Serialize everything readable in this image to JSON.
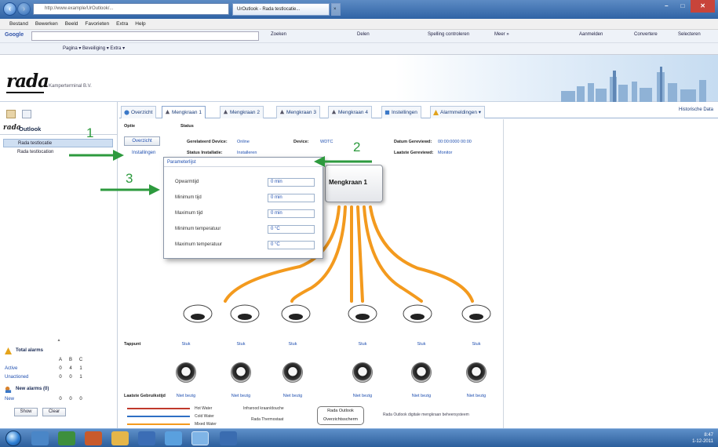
{
  "browser": {
    "tab_active": "UrOutlook - Rada testlocatie...",
    "tab_close": "×",
    "address": "http://www.example/UrOutlook/...",
    "menu": [
      "Bestand",
      "Bewerken",
      "Beeld",
      "Favorieten",
      "Extra",
      "Help"
    ],
    "google_label": "Google",
    "toolbar1_items": [
      "Zoeken",
      "Delen",
      "Spelling controleren",
      "Meer »",
      "Aanmelden"
    ],
    "toolbar2": "Pagina ▾   Beveiliging ▾   Extra ▾",
    "toolbar2_right": [
      "Convertere",
      "Selecteren"
    ]
  },
  "app": {
    "logo": "rada",
    "user_line": "Kamperterminal B.V.",
    "outlook_logo": "rada",
    "outlook_title": "Outlook",
    "historic_link": "Historische Data",
    "tabs": [
      {
        "label": "Overzicht"
      },
      {
        "label": "Mengkraan 1"
      },
      {
        "label": "Mengkraan 2"
      },
      {
        "label": "Mengkraan 3"
      },
      {
        "label": "Mengkraan 4"
      },
      {
        "label": "Instellingen"
      },
      {
        "label": "Alarmmeldingen ▾"
      }
    ]
  },
  "left_panel": {
    "items": [
      "Rada testlocatie",
      "Rada testlocation"
    ],
    "alarms": {
      "total_title": "Total alarms",
      "cols": [
        "A",
        "B",
        "C"
      ],
      "rows": [
        {
          "label": "Active",
          "vals": [
            "0",
            "4",
            "1"
          ]
        },
        {
          "label": "Unactioned",
          "vals": [
            "0",
            "0",
            "1"
          ]
        }
      ],
      "new_title": "New alarms (0)",
      "new_row": {
        "label": "New",
        "vals": [
          "0",
          "0",
          "0"
        ]
      },
      "show_btn": "Show",
      "clear_btn": "Clear"
    }
  },
  "main": {
    "option_label": "Optie",
    "status_label": "Status",
    "overview_btn": "Overzicht",
    "install_link": "Installingen",
    "info": [
      {
        "label": "Gerelateerd Device:",
        "value": "Online"
      },
      {
        "label": "Device:",
        "value": "WDTC"
      },
      {
        "label": "Datum Gereviewd:",
        "value": "00:00:0000 00:00"
      },
      {
        "label": "Status Installatie:",
        "value": "Installeren"
      },
      {
        "label": "Laatste Gereviewd:",
        "value": "Monitor"
      }
    ],
    "popup": {
      "title": "Parameterlijst",
      "rows": [
        {
          "label": "Opwarmtijd",
          "value": "0 min"
        },
        {
          "label": "Minimum tijd",
          "value": "0 min"
        },
        {
          "label": "Maximum tijd",
          "value": "0 min"
        },
        {
          "label": "Minimum temperatuur",
          "value": "0 °C"
        },
        {
          "label": "Maximum temperatuur",
          "value": "0 °C"
        }
      ]
    },
    "mixer_label": "Mengkraan 1",
    "tappunt_label": "Tappunt",
    "outlet_vals": [
      "Stuk",
      "Stuk",
      "Stuk",
      "Stuk",
      "Stuk",
      "Stuk"
    ],
    "last_used_label": "Laatste Gebruikstijd",
    "outlet_status": [
      "Niet bezig",
      "Niet bezig",
      "Niet bezig",
      "Niet bezig",
      "Niet bezig",
      "Niet bezig"
    ],
    "legend": {
      "hot": "Hot Water",
      "cold": "Cold Water",
      "mixed": "Mixed Water",
      "valve": "Infrarood kraan/douche",
      "flush": "Rada Thermostaat"
    },
    "rada_box": [
      "Rada Outlook",
      "Overzichtsscherm"
    ],
    "footer_note": "Rada Outlook digitale mengkraan beheersysteem"
  },
  "annotations": [
    "1",
    "2",
    "3"
  ],
  "taskbar": {
    "time": "8:47",
    "date": "1-12-2011"
  },
  "colors": {
    "pipe": "#f39a1e",
    "accent_green": "#2d9a3e",
    "link_blue": "#1f4fb0"
  }
}
